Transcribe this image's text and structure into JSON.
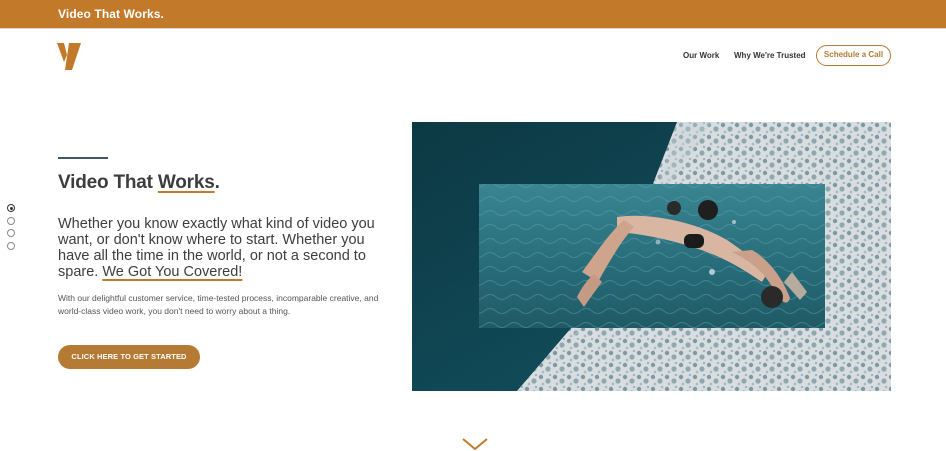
{
  "topbar": {
    "title": "Video That Works."
  },
  "nav": {
    "items": [
      {
        "label": "Our Work"
      },
      {
        "label": "Why We're Trusted"
      }
    ],
    "cta_label": "Schedule a Call"
  },
  "section_dots": {
    "count": 4,
    "active_index": 0
  },
  "hero": {
    "title_prefix": "Video That ",
    "title_highlight": "Works",
    "title_suffix": ".",
    "lead_text": "Whether you know exactly what kind of video you want, or don't know where to start. Whether you have all the time in the world, or not a second to spare. ",
    "lead_highlight": "We Got You Covered!",
    "body": "With our delightful customer service, time-tested process, incomparable creative, and world-class video work, you don't need to worry about a thing.",
    "cta_label": "CLICK HERE TO GET STARTED"
  },
  "colors": {
    "accent": "#c27a2a",
    "button": "#b57a33",
    "text_dark": "#3d3d3d",
    "rule": "#44556a"
  },
  "icons": {
    "logo": "brand-v-logo",
    "scroll": "chevron-down-icon"
  }
}
